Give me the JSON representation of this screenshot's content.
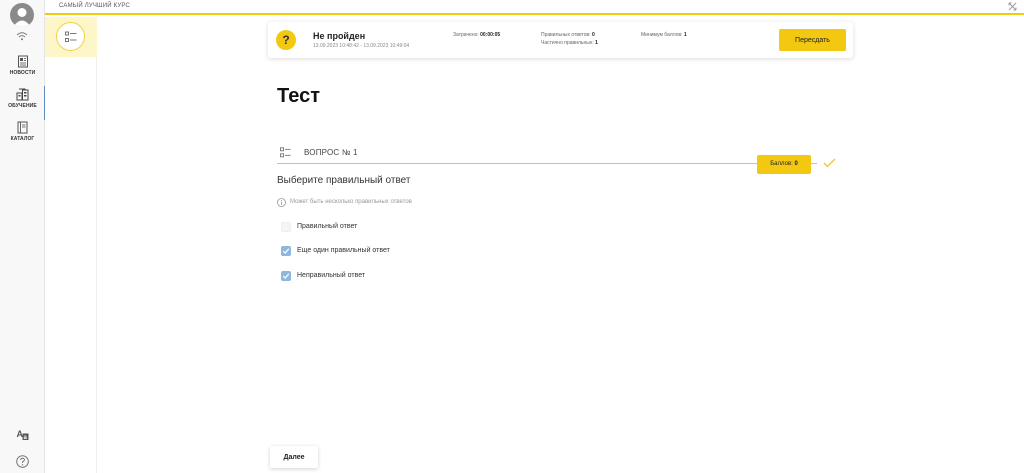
{
  "topbar": {
    "course_title": "САМЫЙ ЛУЧШИЙ КУРС",
    "close_icon": "close-icon"
  },
  "nav": {
    "items": [
      {
        "label": "НОВОСТИ",
        "icon": "news-icon"
      },
      {
        "label": "ОБУЧЕНИЕ",
        "icon": "learning-icon",
        "active": true
      },
      {
        "label": "КАТАЛОГ",
        "icon": "catalog-icon"
      }
    ],
    "bottom_icons": [
      "translate-icon",
      "help-icon"
    ]
  },
  "result": {
    "badge": "?",
    "status": "Не пройден",
    "dates": "13.09.2023 10:48:42 - 13.09.2023 10:49:04",
    "time_label": "Затрачено:",
    "time_value": "00:00:05",
    "correct_label": "Правильных ответов:",
    "correct_value": "0",
    "partial_label": "Частично правильных:",
    "partial_value": "1",
    "min_label": "Минимум баллов:",
    "min_value": "1",
    "retake_label": "Пересдать"
  },
  "page": {
    "title": "Тест"
  },
  "question": {
    "label": "ВОПРОС № 1",
    "score_label": "Баллов:",
    "score_value": "0",
    "text": "Выберите правильный ответ",
    "hint": "Может быть несколько правильных ответов",
    "options": [
      {
        "label": "Правильный ответ",
        "checked": false
      },
      {
        "label": "Еще один правильный ответ",
        "checked": true
      },
      {
        "label": "Неправильный ответ",
        "checked": true
      }
    ]
  },
  "footer": {
    "next_label": "Далее"
  },
  "colors": {
    "accent": "#f2c811",
    "checkbox": "#8fb6de",
    "nav_active": "#5b8ec2"
  }
}
